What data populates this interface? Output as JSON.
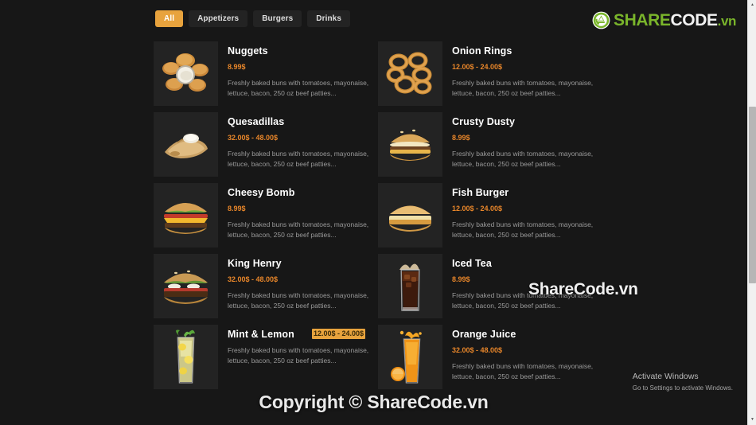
{
  "header": {
    "tabs": [
      {
        "label": "All",
        "active": true
      },
      {
        "label": "Appetizers",
        "active": false
      },
      {
        "label": "Burgers",
        "active": false
      },
      {
        "label": "Drinks",
        "active": false
      }
    ],
    "logo": {
      "icon": "recycle-circle-icon",
      "part_share": "SHARE",
      "part_code": "CODE",
      "part_tld": ".vn",
      "color_green": "#7ab52b",
      "color_white": "#f2f2f2"
    }
  },
  "menu": {
    "items": [
      {
        "name": "Nuggets",
        "price": "8.99$",
        "price_highlighted": false,
        "description": "Freshly baked buns with tomatoes, mayonaise, lettuce, bacon, 250 oz beef patties...",
        "image": "nuggets-image"
      },
      {
        "name": "Onion Rings",
        "price": "12.00$ - 24.00$",
        "price_highlighted": false,
        "description": "Freshly baked buns with tomatoes, mayonaise, lettuce, bacon, 250 oz beef patties...",
        "image": "onion-rings-image"
      },
      {
        "name": "Quesadillas",
        "price": "32.00$ - 48.00$",
        "price_highlighted": false,
        "description": "Freshly baked buns with tomatoes, mayonaise, lettuce, bacon, 250 oz beef patties...",
        "image": "quesadillas-image"
      },
      {
        "name": "Crusty Dusty",
        "price": "8.99$",
        "price_highlighted": false,
        "description": "Freshly baked buns with tomatoes, mayonaise, lettuce, bacon, 250 oz beef patties...",
        "image": "crusty-dusty-burger-image"
      },
      {
        "name": "Cheesy Bomb",
        "price": "8.99$",
        "price_highlighted": false,
        "description": "Freshly baked buns with tomatoes, mayonaise, lettuce, bacon, 250 oz beef patties...",
        "image": "cheesy-bomb-burger-image"
      },
      {
        "name": "Fish Burger",
        "price": "12.00$ - 24.00$",
        "price_highlighted": false,
        "description": "Freshly baked buns with tomatoes, mayonaise, lettuce, bacon, 250 oz beef patties...",
        "image": "fish-burger-image"
      },
      {
        "name": "King Henry",
        "price": "32.00$ - 48.00$",
        "price_highlighted": false,
        "description": "Freshly baked buns with tomatoes, mayonaise, lettuce, bacon, 250 oz beef patties...",
        "image": "king-henry-burger-image"
      },
      {
        "name": "Iced Tea",
        "price": "8.99$",
        "price_highlighted": false,
        "description": "Freshly baked buns with tomatoes, mayonaise, lettuce, bacon, 250 oz beef patties...",
        "image": "iced-tea-image"
      },
      {
        "name": "Mint & Lemon",
        "price": "12.00$ - 24.00$",
        "price_highlighted": true,
        "description": "Freshly baked buns with tomatoes, mayonaise, lettuce, bacon, 250 oz beef patties...",
        "image": "mint-lemon-drink-image"
      },
      {
        "name": "Orange Juice",
        "price": "32.00$ - 48.00$",
        "price_highlighted": false,
        "description": "Freshly baked buns with tomatoes, mayonaise, lettuce, bacon, 250 oz beef patties...",
        "image": "orange-juice-image"
      }
    ]
  },
  "watermarks": {
    "center": "ShareCode.vn",
    "footer": "Copyright © ShareCode.vn"
  },
  "windows_activation": {
    "title": "Activate Windows",
    "subtitle": "Go to Settings to activate Windows."
  },
  "colors": {
    "background": "#171717",
    "accent_orange": "#e8a33d",
    "price_orange": "#e8862a",
    "thumb_bg": "#232323",
    "tab_bg": "#232323",
    "description_gray": "#9a9a9a"
  },
  "scrollbar": {
    "up_arrow": "▲",
    "down_arrow": "▼"
  }
}
